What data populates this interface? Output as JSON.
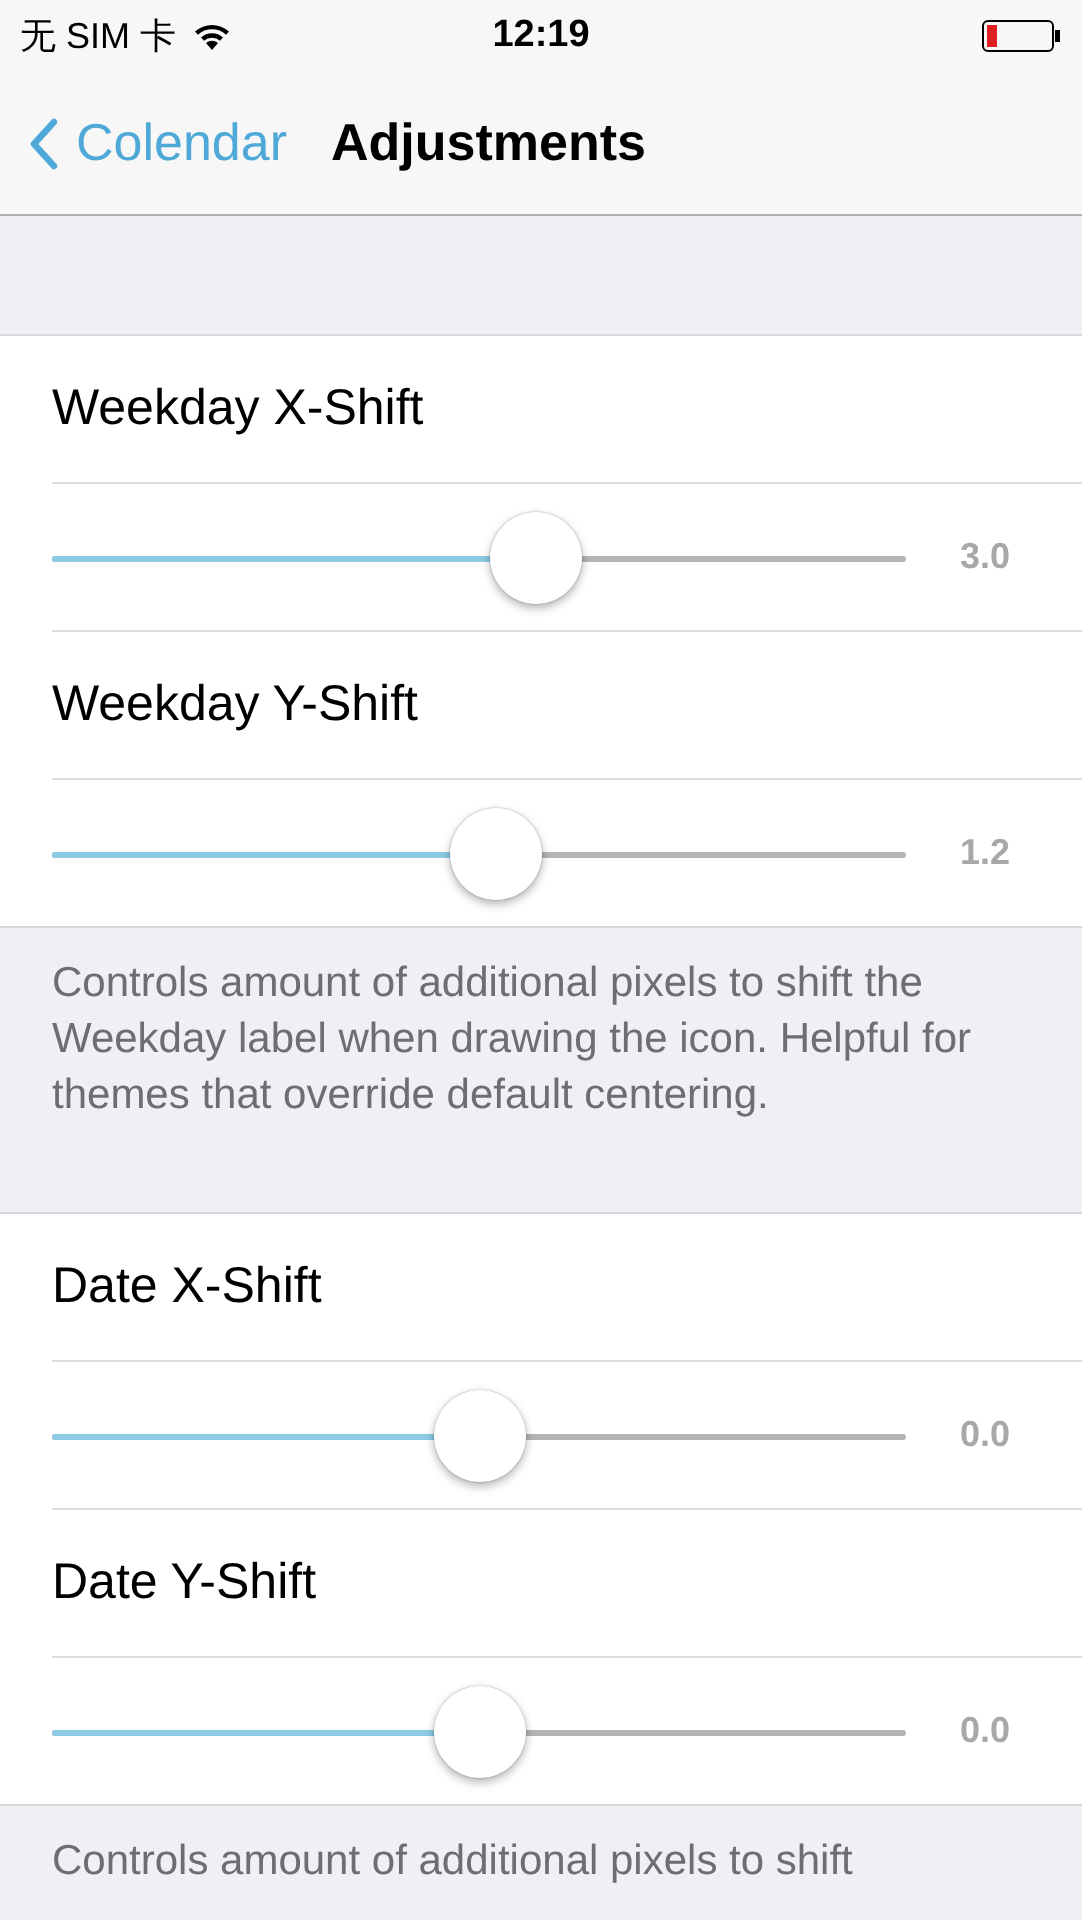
{
  "status_bar": {
    "carrier": "无 SIM 卡",
    "time": "12:19"
  },
  "nav": {
    "back": "Colendar",
    "title": "Adjustments"
  },
  "sections": [
    {
      "rows": [
        {
          "label": "Weekday X-Shift",
          "level": 0.567,
          "reading": "3.0"
        },
        {
          "label": "Weekday Y-Shift",
          "level": 0.52,
          "reading": "1.2"
        }
      ],
      "footer": "Controls amount of additional pixels to shift the Weekday label when drawing the icon. Helpful for themes that override default centering."
    },
    {
      "rows": [
        {
          "label": "Date X-Shift",
          "level": 0.5,
          "reading": "0.0"
        },
        {
          "label": "Date Y-Shift",
          "level": 0.5,
          "reading": "0.0"
        }
      ],
      "footer": "Controls amount of additional pixels to shift"
    }
  ]
}
